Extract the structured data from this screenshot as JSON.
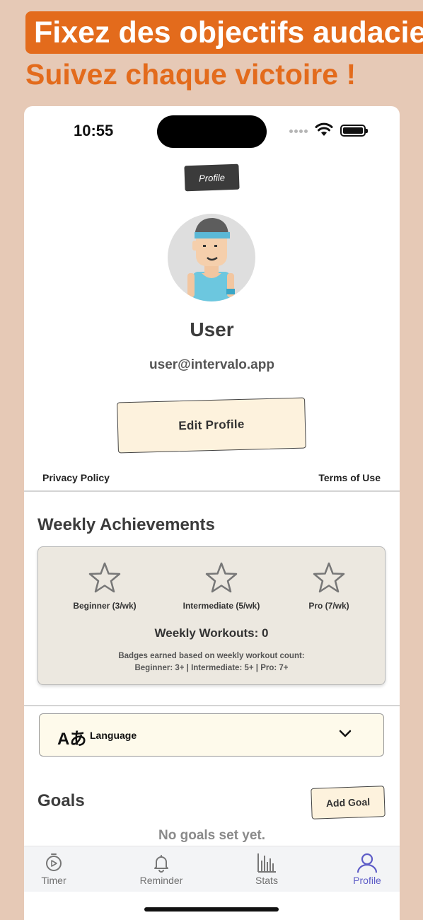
{
  "promo": {
    "line1": "Fixez des objectifs audacieux",
    "line2": "Suivez chaque victoire !",
    "accent": "#e36b1c"
  },
  "status_bar": {
    "time": "10:55"
  },
  "header": {
    "tag": "Profile"
  },
  "profile": {
    "name": "User",
    "email": "user@intervalo.app",
    "edit_label": "Edit Profile"
  },
  "links": {
    "privacy": "Privacy Policy",
    "terms": "Terms of Use"
  },
  "achievements": {
    "title": "Weekly Achievements",
    "badges": [
      {
        "label": "Beginner (3/wk)",
        "icon": "star-outline-icon"
      },
      {
        "label": "Intermediate (5/wk)",
        "icon": "star-outline-icon"
      },
      {
        "label": "Pro (7/wk)",
        "icon": "star-outline-icon"
      }
    ],
    "weekly_workouts": "Weekly Workouts: 0",
    "note_line1": "Badges earned based on weekly workout count:",
    "note_line2": "Beginner: 3+ | Intermediate: 5+ | Pro: 7+"
  },
  "language": {
    "icon_text": "Aあ",
    "label": "Language"
  },
  "goals": {
    "title": "Goals",
    "add_label": "Add Goal",
    "empty": "No goals set yet."
  },
  "tabbar": {
    "items": [
      {
        "label": "Timer",
        "icon": "timer-icon"
      },
      {
        "label": "Reminder",
        "icon": "bell-icon"
      },
      {
        "label": "Stats",
        "icon": "bar-chart-icon"
      },
      {
        "label": "Profile",
        "icon": "user-icon"
      }
    ],
    "active": "Profile",
    "active_color": "#5d5cc7"
  }
}
